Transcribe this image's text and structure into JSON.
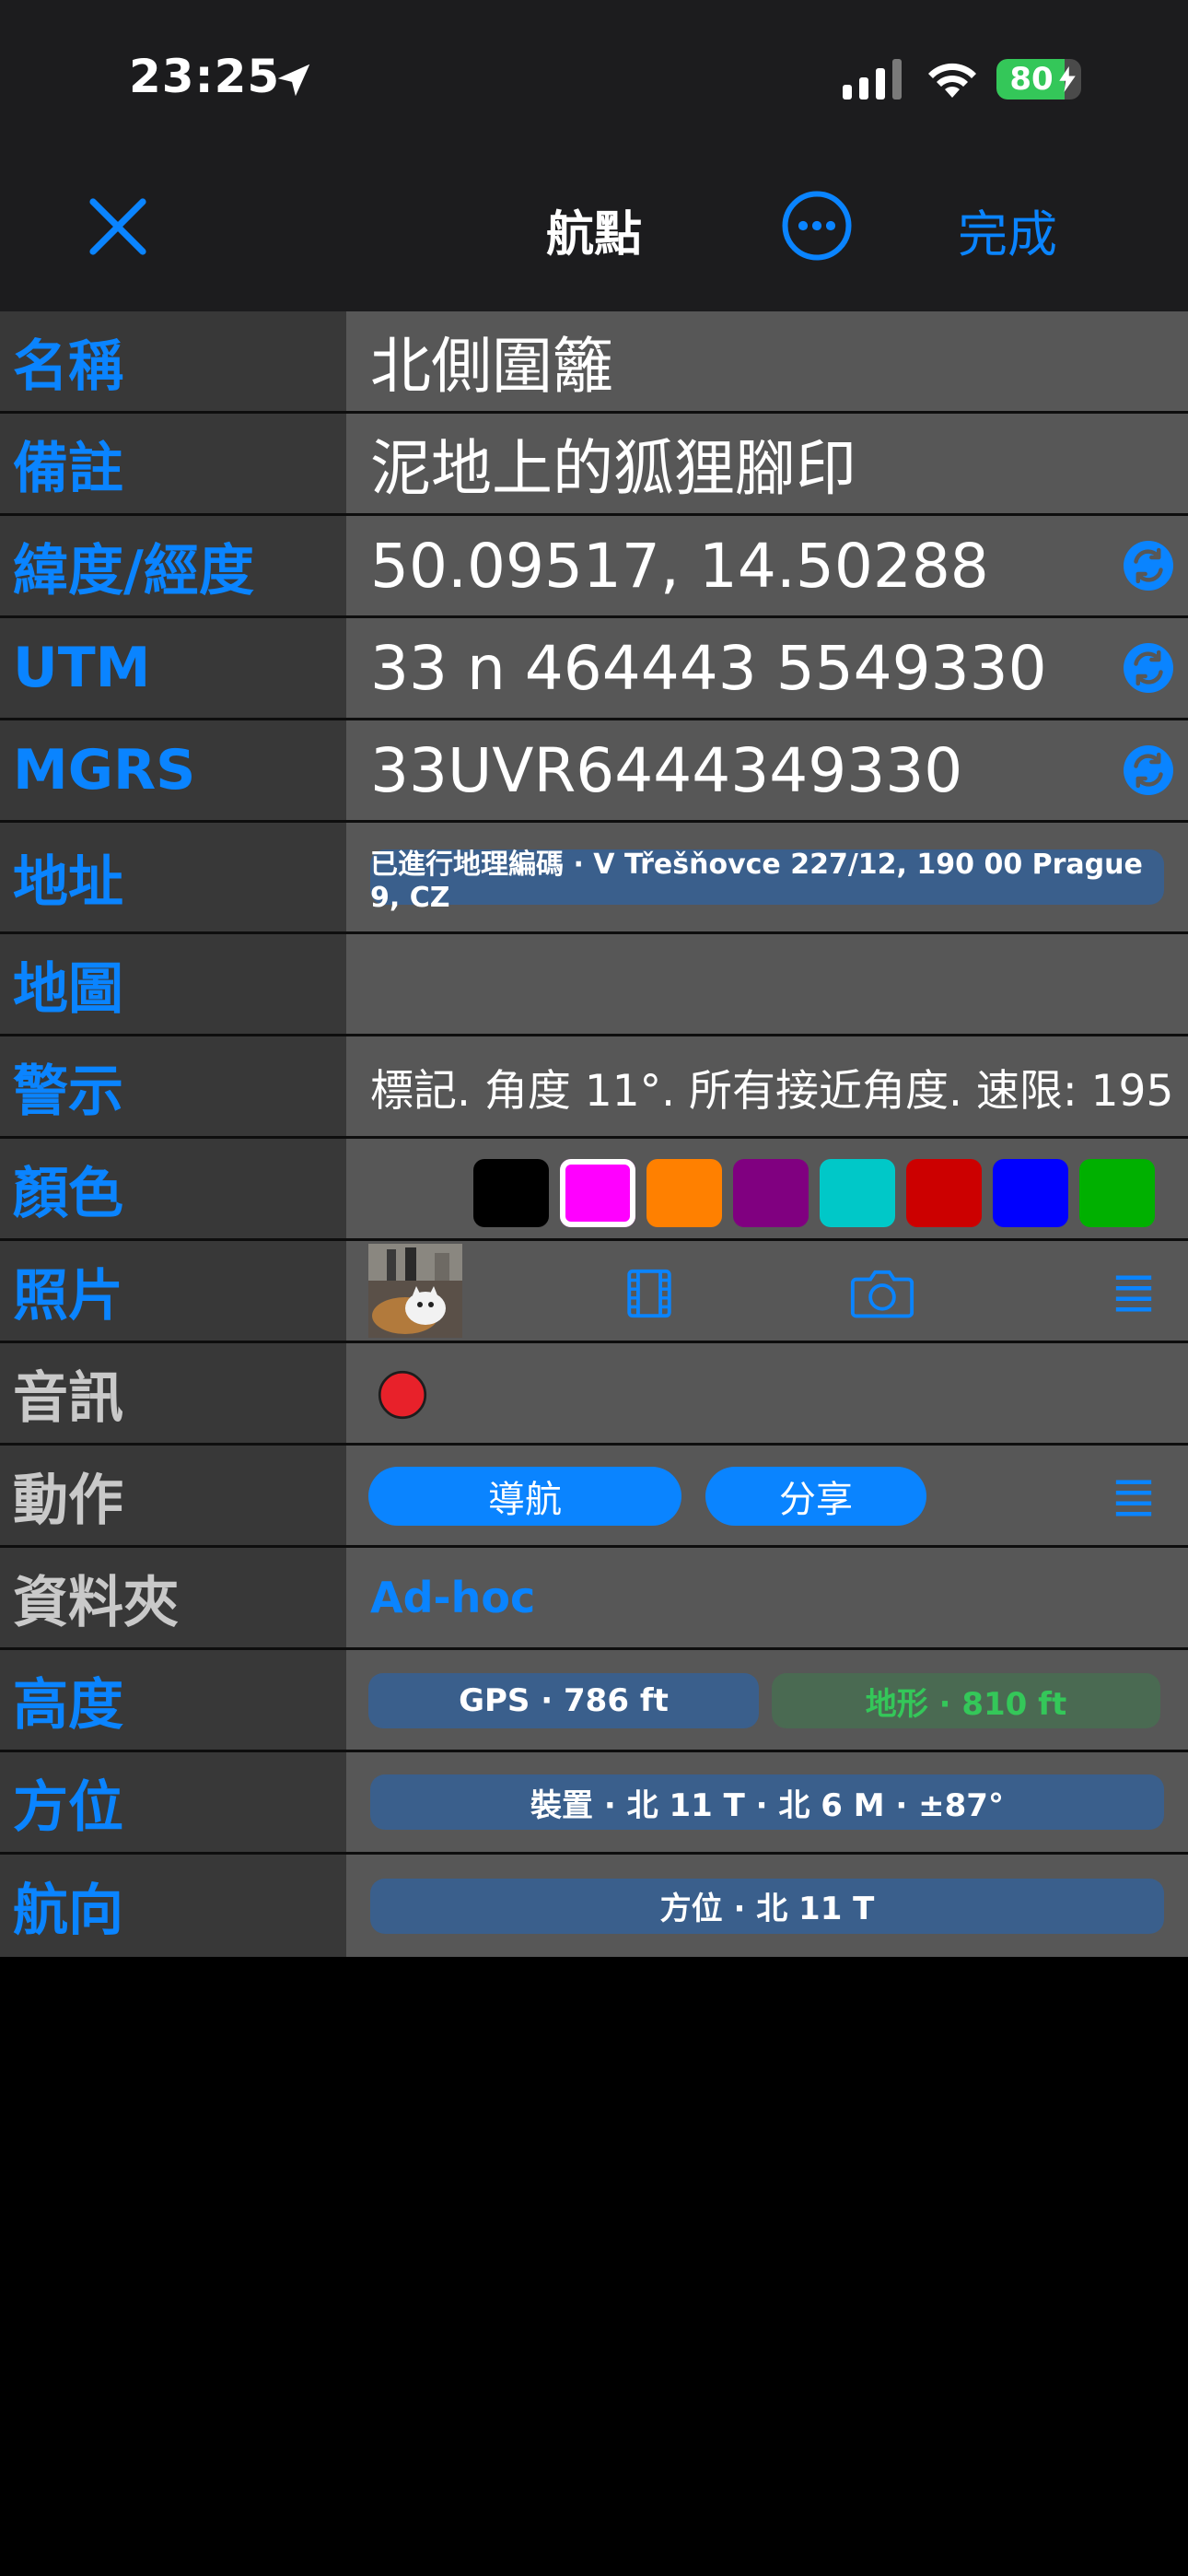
{
  "status_bar": {
    "time": "23:25",
    "battery_percent": 80,
    "battery_label": "80"
  },
  "nav": {
    "close_icon": "close-x",
    "title": "航點",
    "more_icon": "ellipsis-circle",
    "done_label": "完成"
  },
  "rows": {
    "name": {
      "label": "名稱",
      "value": "北側圍籬"
    },
    "note": {
      "label": "備註",
      "value": "泥地上的狐狸腳印"
    },
    "latlon": {
      "label": "緯度/經度",
      "value": "50.09517, 14.50288"
    },
    "utm": {
      "label": "UTM",
      "value": "33 n 464443 5549330"
    },
    "mgrs": {
      "label": "MGRS",
      "value": "33UVR6444349330"
    },
    "address": {
      "label": "地址",
      "value": "已進行地理編碼 · V Třešňovce 227/12, 190 00 Prague 9, CZ"
    },
    "map": {
      "label": "地圖",
      "value": ""
    },
    "alert": {
      "label": "警示",
      "value": "標記. 角度 11°. 所有接近角度. 速限: 195"
    },
    "color": {
      "label": "顏色",
      "swatches": [
        "#000000",
        "#ff00ff",
        "#ff8000",
        "#800080",
        "#00c8c8",
        "#cc0000",
        "#0000ff",
        "#00b000"
      ],
      "selected_index": 1
    },
    "photo": {
      "label": "照片"
    },
    "audio": {
      "label": "音訊"
    },
    "action": {
      "label": "動作",
      "navigate": "導航",
      "share": "分享"
    },
    "folder": {
      "label": "資料夾",
      "value": "Ad-hoc"
    },
    "altitude": {
      "label": "高度",
      "gps": "GPS · 786 ft",
      "terrain": "地形 · 810 ft"
    },
    "bearing": {
      "label": "方位",
      "value": "裝置 · 北 11 T · 北 6 M · ±87°"
    },
    "heading": {
      "label": "航向",
      "value": "方位 · 北 11 T"
    }
  },
  "colors": {
    "accent": "#0a84ff",
    "terrain_text": "#34c759"
  }
}
